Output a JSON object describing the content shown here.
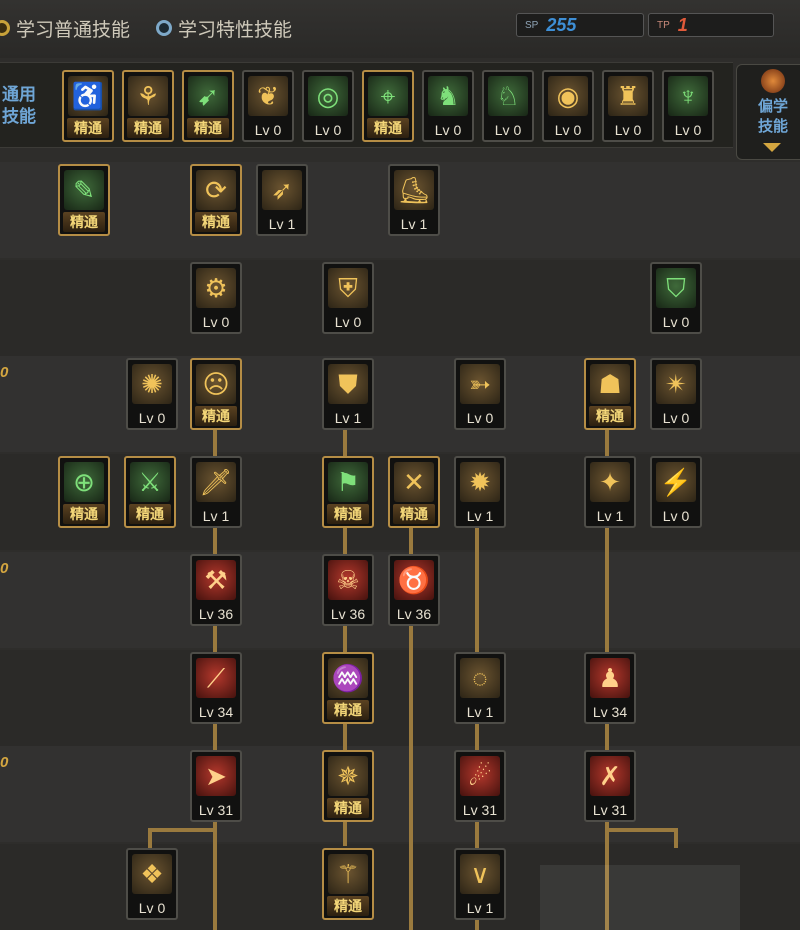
{
  "tabs": [
    {
      "label": "学习普通技能",
      "selected": true
    },
    {
      "label": "学习特性技能",
      "selected": false
    }
  ],
  "counters": {
    "sp": {
      "label": "SP",
      "value": "255",
      "color": "#3e8fd6"
    },
    "tp": {
      "label": "TP",
      "value": "1",
      "color": "#e05a3a"
    }
  },
  "general_label": "通用技能",
  "learn_button": {
    "label": "偏学技能",
    "icon": "orb-icon"
  },
  "row_labels": [
    "0",
    "0",
    "0"
  ],
  "mastered_text": "精通",
  "general_skills": [
    {
      "icon": "sit-icon",
      "color": "gold",
      "level": "精通",
      "mastered": true
    },
    {
      "icon": "crouch-icon",
      "color": "gold",
      "level": "精通",
      "mastered": true
    },
    {
      "icon": "dash-icon",
      "color": "green",
      "level": "精通",
      "mastered": true
    },
    {
      "icon": "wing-icon",
      "color": "gold",
      "level": "Lv 0",
      "mastered": false
    },
    {
      "icon": "target-icon",
      "color": "green",
      "level": "Lv 0",
      "mastered": false
    },
    {
      "icon": "crosshair-icon",
      "color": "green",
      "level": "精通",
      "mastered": true
    },
    {
      "icon": "kick-icon",
      "color": "green",
      "level": "Lv 0",
      "mastered": false
    },
    {
      "icon": "kick2-icon",
      "color": "green",
      "level": "Lv 0",
      "mastered": false
    },
    {
      "icon": "eye-icon",
      "color": "gold",
      "level": "Lv 0",
      "mastered": false
    },
    {
      "icon": "flex-icon",
      "color": "gold",
      "level": "Lv 0",
      "mastered": false
    },
    {
      "icon": "spirit-icon",
      "color": "green",
      "level": "Lv 0",
      "mastered": false
    }
  ],
  "tree_skills": [
    {
      "icon": "scroll-icon",
      "color": "green",
      "level": "精通",
      "mastered": true
    },
    {
      "icon": "cycle-icon",
      "color": "gold",
      "level": "精通",
      "mastered": true
    },
    {
      "icon": "feather-icon",
      "color": "gold",
      "level": "Lv 1",
      "mastered": false
    },
    {
      "icon": "boot-icon",
      "color": "gold",
      "level": "Lv 1",
      "mastered": false
    },
    {
      "icon": "gear-icon",
      "color": "gold",
      "level": "Lv 0",
      "mastered": false
    },
    {
      "icon": "shoulder-icon",
      "color": "gold",
      "level": "Lv 0",
      "mastered": false
    },
    {
      "icon": "shield-icon",
      "color": "green",
      "level": "Lv 0",
      "mastered": false
    },
    {
      "icon": "burst-icon",
      "color": "gold",
      "level": "Lv 0",
      "mastered": false
    },
    {
      "icon": "face-icon",
      "color": "gold",
      "level": "精通",
      "mastered": true
    },
    {
      "icon": "guard-icon",
      "color": "gold",
      "level": "Lv 1",
      "mastered": false
    },
    {
      "icon": "fire-arrow-icon",
      "color": "gold",
      "level": "Lv 0",
      "mastered": false
    },
    {
      "icon": "cat-icon",
      "color": "gold",
      "level": "精通",
      "mastered": true
    },
    {
      "icon": "slam-icon",
      "color": "gold",
      "level": "Lv 0",
      "mastered": false
    },
    {
      "icon": "reticle-icon",
      "color": "green",
      "level": "精通",
      "mastered": true
    },
    {
      "icon": "blades-icon",
      "color": "green",
      "level": "精通",
      "mastered": true
    },
    {
      "icon": "sword-icon",
      "color": "gold",
      "level": "Lv 1",
      "mastered": false
    },
    {
      "icon": "run-icon",
      "color": "green",
      "level": "精通",
      "mastered": true
    },
    {
      "icon": "cross-icon",
      "color": "gold",
      "level": "精通",
      "mastered": true
    },
    {
      "icon": "crash-icon",
      "color": "gold",
      "level": "Lv 1",
      "mastered": false
    },
    {
      "icon": "strike-icon",
      "color": "gold",
      "level": "Lv 1",
      "mastered": false
    },
    {
      "icon": "slash-icon",
      "color": "gold",
      "level": "Lv 0",
      "mastered": false
    },
    {
      "icon": "axe-icon",
      "color": "red",
      "level": "Lv 36",
      "mastered": false
    },
    {
      "icon": "skull-icon",
      "color": "red",
      "level": "Lv 36",
      "mastered": false
    },
    {
      "icon": "beast-icon",
      "color": "red",
      "level": "Lv 36",
      "mastered": false
    },
    {
      "icon": "blade-icon",
      "color": "red",
      "level": "Lv 34",
      "mastered": false
    },
    {
      "icon": "fangs-icon",
      "color": "gold",
      "level": "精通",
      "mastered": true
    },
    {
      "icon": "vortex-icon",
      "color": "gold",
      "level": "Lv 1",
      "mastered": false
    },
    {
      "icon": "kneel-icon",
      "color": "red",
      "level": "Lv 34",
      "mastered": false
    },
    {
      "icon": "sprint-icon",
      "color": "red",
      "level": "Lv 31",
      "mastered": false
    },
    {
      "icon": "explosion-icon",
      "color": "gold",
      "level": "精通",
      "mastered": true
    },
    {
      "icon": "comet-icon",
      "color": "red",
      "level": "Lv 31",
      "mastered": false
    },
    {
      "icon": "x-slash-icon",
      "color": "red",
      "level": "Lv 31",
      "mastered": false
    },
    {
      "icon": "rune-icon",
      "color": "gold",
      "level": "Lv 0",
      "mastered": false
    },
    {
      "icon": "claw-icon",
      "color": "gold",
      "level": "精通",
      "mastered": true
    },
    {
      "icon": "v-slash-icon",
      "color": "gold",
      "level": "Lv 1",
      "mastered": false
    }
  ]
}
